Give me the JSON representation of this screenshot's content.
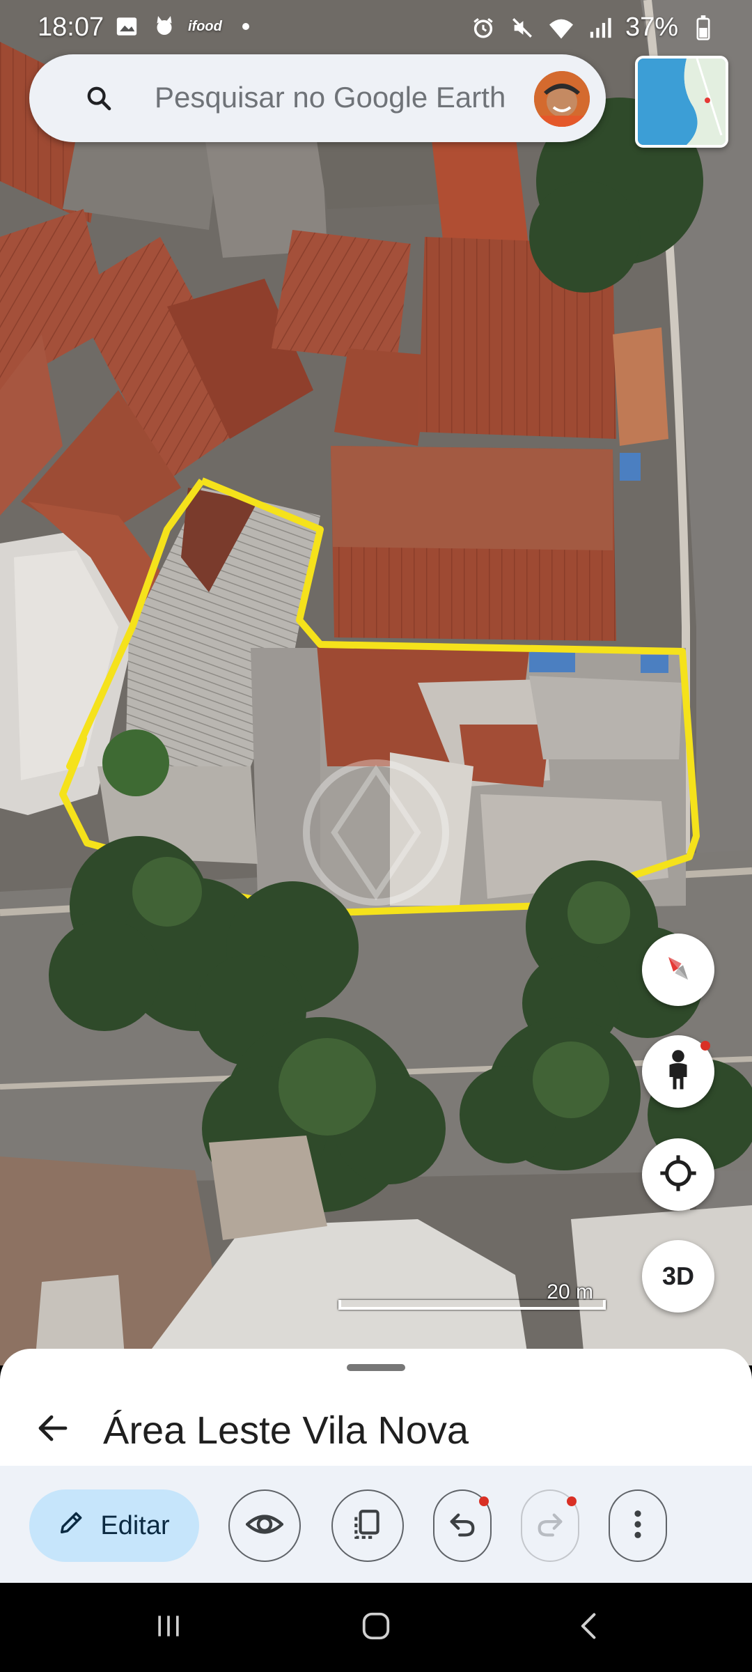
{
  "status_bar": {
    "time": "18:07",
    "app_label": "ifood",
    "battery": "37%",
    "left_icons": [
      "image-icon",
      "cat-icon",
      "ifood-icon",
      "dot-icon"
    ],
    "right_icons": [
      "alarm-icon",
      "mute-icon",
      "wifi-icon",
      "signal-icon",
      "battery-icon"
    ]
  },
  "search": {
    "placeholder": "Pesquisar no Google Earth"
  },
  "map": {
    "scale_label": "20 m",
    "controls": [
      "compass-button",
      "pegman-button",
      "my-location-button",
      "3d-button"
    ],
    "three_d_label": "3D",
    "polygon_color": "#f5e21b"
  },
  "sheet": {
    "title": "Área Leste Vila Nova",
    "edit_label": "Editar",
    "tools": [
      "eye-icon",
      "copy-icon",
      "undo-icon",
      "redo-icon",
      "more-icon"
    ]
  },
  "colors": {
    "accent": "#c6e5fb",
    "notification_dot": "#d93025"
  }
}
